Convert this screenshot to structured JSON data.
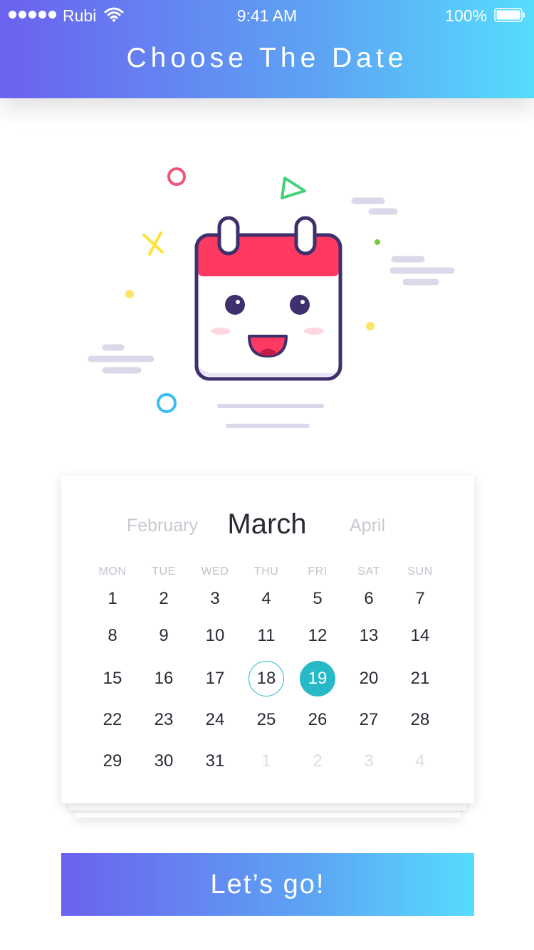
{
  "status_bar": {
    "carrier": "Rubi",
    "time": "9:41 AM",
    "battery": "100%"
  },
  "header": {
    "title": "Choose The Date"
  },
  "calendar": {
    "prev_month": "February",
    "current_month": "March",
    "next_month": "April",
    "weekdays": [
      "MON",
      "TUE",
      "WED",
      "THU",
      "FRI",
      "SAT",
      "SUN"
    ],
    "weeks": [
      [
        "1",
        "2",
        "3",
        "4",
        "5",
        "6",
        "7"
      ],
      [
        "8",
        "9",
        "10",
        "11",
        "12",
        "13",
        "14"
      ],
      [
        "15",
        "16",
        "17",
        "18",
        "19",
        "20",
        "21"
      ],
      [
        "22",
        "23",
        "24",
        "25",
        "26",
        "27",
        "28"
      ],
      [
        "29",
        "30",
        "31",
        "1",
        "2",
        "3",
        "4"
      ]
    ],
    "today_day": "18",
    "selected_day": "19",
    "accent_color": "#27b9c7"
  },
  "cta": {
    "label": "Let’s go!"
  }
}
